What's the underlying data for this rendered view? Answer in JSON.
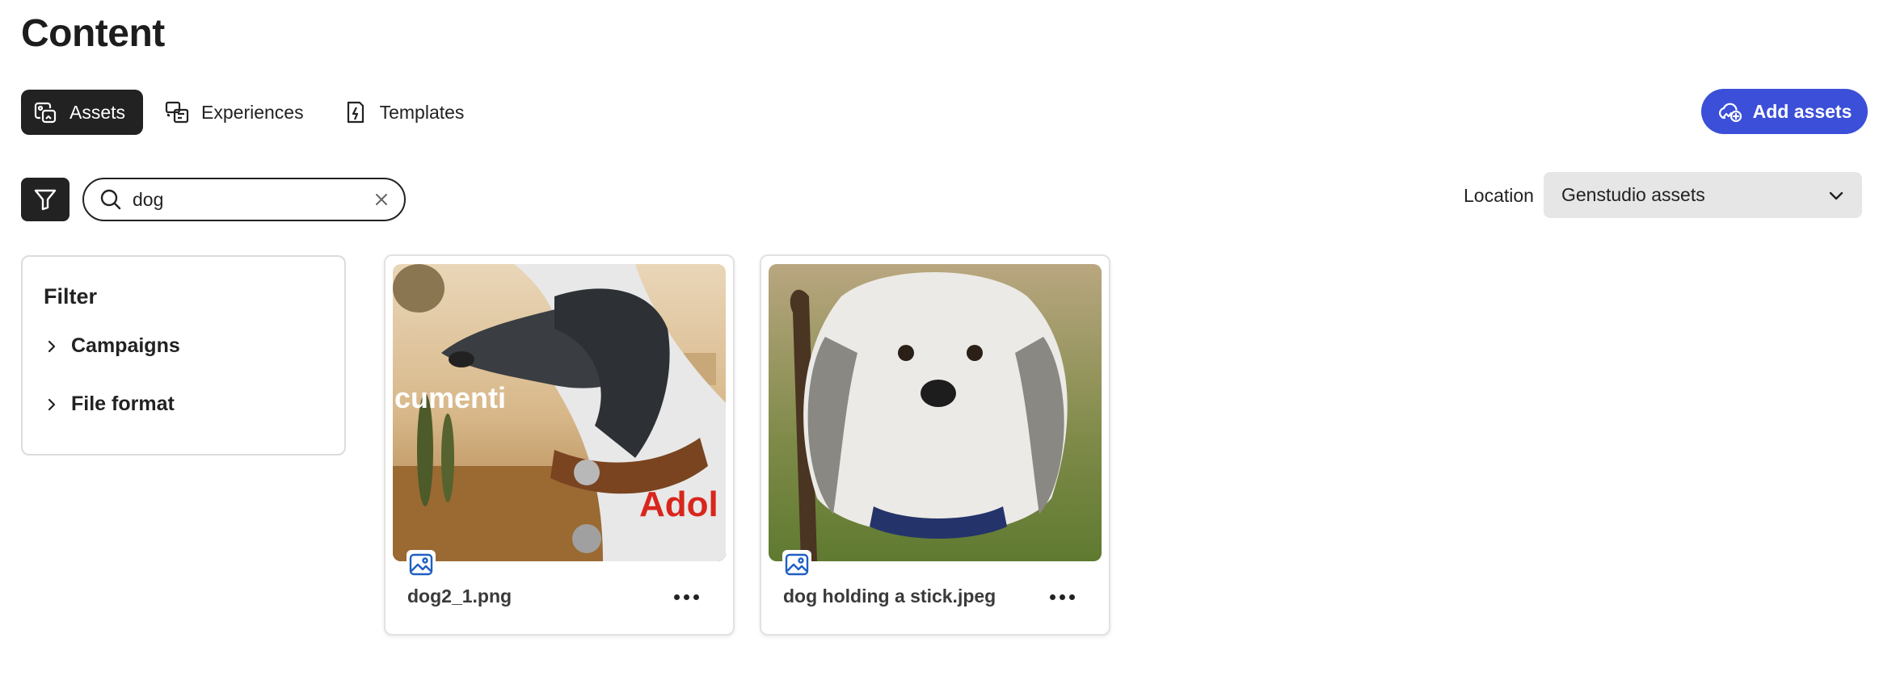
{
  "page": {
    "title": "Content"
  },
  "tabs": [
    {
      "label": "Assets",
      "icon": "assets-icon",
      "active": true
    },
    {
      "label": "Experiences",
      "icon": "experiences-icon",
      "active": false
    },
    {
      "label": "Templates",
      "icon": "templates-icon",
      "active": false
    }
  ],
  "actions": {
    "add_assets_label": "Add assets"
  },
  "search": {
    "value": "dog",
    "placeholder": ""
  },
  "location": {
    "label": "Location",
    "selected": "Genstudio assets"
  },
  "filter": {
    "title": "Filter",
    "groups": [
      {
        "label": "Campaigns"
      },
      {
        "label": "File format"
      }
    ]
  },
  "assets": [
    {
      "name": "dog2_1.png",
      "type": "image"
    },
    {
      "name": "dog holding a stick.jpeg",
      "type": "image"
    }
  ],
  "colors": {
    "accent": "#3b4fd8",
    "dark": "#222222",
    "select_bg": "#e6e6e6"
  }
}
